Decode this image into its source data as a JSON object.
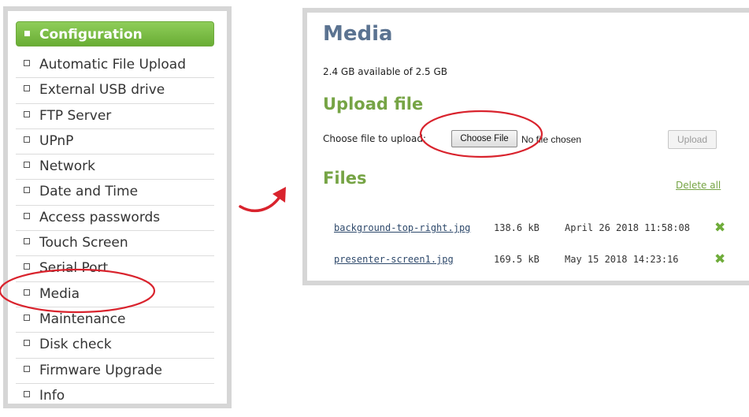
{
  "sidebar": {
    "header_label": "Configuration",
    "items": [
      {
        "label": "Automatic File Upload"
      },
      {
        "label": "External USB drive"
      },
      {
        "label": "FTP Server"
      },
      {
        "label": "UPnP"
      },
      {
        "label": "Network"
      },
      {
        "label": "Date and Time"
      },
      {
        "label": "Access passwords"
      },
      {
        "label": "Touch Screen"
      },
      {
        "label": "Serial Port"
      },
      {
        "label": "Media"
      },
      {
        "label": "Maintenance"
      },
      {
        "label": "Disk check"
      },
      {
        "label": "Firmware Upgrade"
      },
      {
        "label": "Info"
      }
    ]
  },
  "media": {
    "title": "Media",
    "storage_info": "2.4 GB available of 2.5 GB",
    "upload": {
      "title": "Upload file",
      "choose_label": "Choose file to upload:",
      "choose_button": "Choose File",
      "no_file_text": "No file chosen",
      "upload_button": "Upload"
    },
    "files": {
      "title": "Files",
      "delete_all": "Delete all",
      "rows": [
        {
          "name": "background-top-right.jpg",
          "size": "138.6 kB",
          "date": "April 26 2018 11:58:08",
          "delete_icon": "x-icon"
        },
        {
          "name": "presenter-screen1.jpg",
          "size": "169.5 kB",
          "date": "May 15 2018 14:23:16",
          "delete_icon": "x-icon"
        }
      ]
    }
  },
  "colors": {
    "header_green": "#7cbd47",
    "title_blue": "#5b7391",
    "section_green": "#76a445",
    "annotation_red": "#d9232d"
  }
}
